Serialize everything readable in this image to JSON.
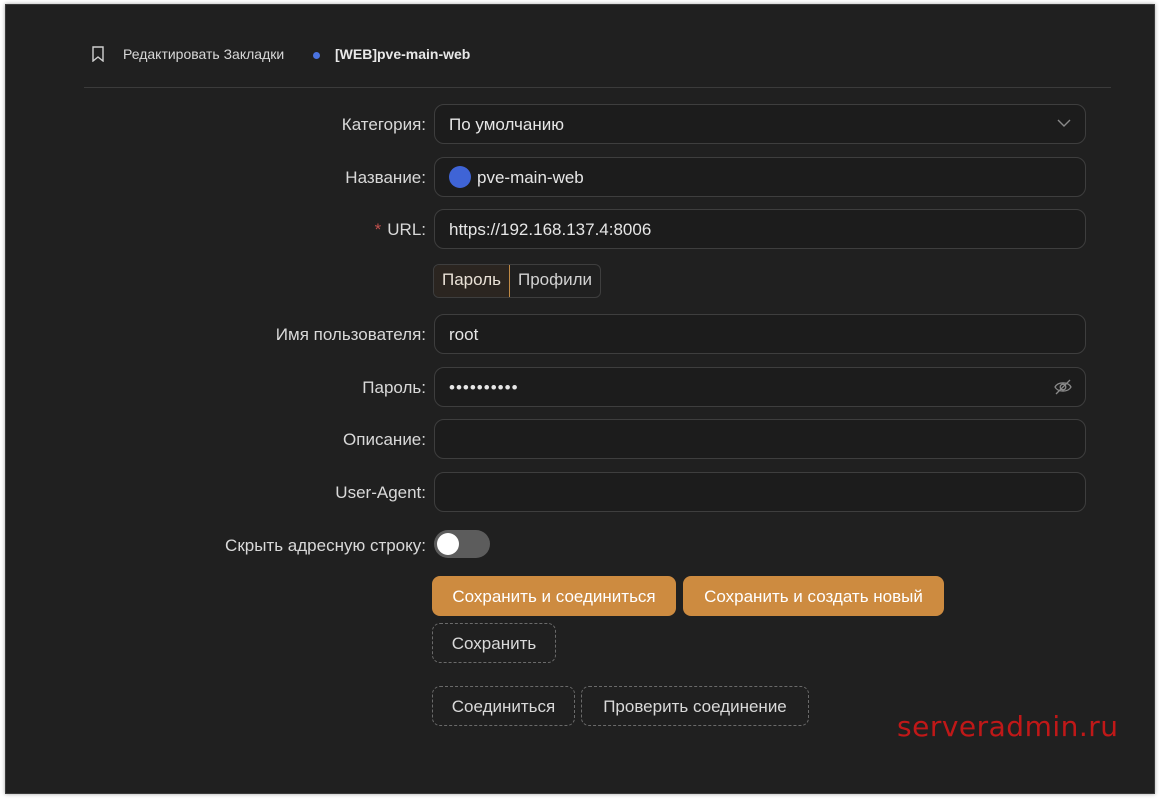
{
  "header": {
    "bookmark_title": "Редактировать Закладки",
    "tab_title": "[WEB]pve-main-web",
    "icon": "bookmark-icon"
  },
  "form": {
    "category": {
      "label": "Категория:",
      "value": "По умолчанию"
    },
    "name": {
      "label": "Название:",
      "value": "pve-main-web",
      "color": "#3f64d6"
    },
    "url": {
      "required_mark": "*",
      "label": "URL:",
      "value": "https://192.168.137.4:8006"
    },
    "auth_tabs": {
      "password": "Пароль",
      "profiles": "Профили",
      "selected": "Пароль"
    },
    "username": {
      "label": "Имя пользователя:",
      "value": "root"
    },
    "password": {
      "label": "Пароль:",
      "value": "••••••••••",
      "icon": "eye-off-icon"
    },
    "description": {
      "label": "Описание:",
      "value": ""
    },
    "user_agent": {
      "label": "User-Agent:",
      "value": ""
    },
    "hide_address_bar": {
      "label": "Скрыть адресную строку:",
      "state": "off"
    }
  },
  "buttons": {
    "save_connect": "Сохранить и соединиться",
    "save_new": "Сохранить и создать новый",
    "save": "Сохранить",
    "connect": "Соединиться",
    "test_connection": "Проверить соединение"
  },
  "watermark": "serveradmin.ru",
  "colors": {
    "accent": "#cd8b40",
    "background": "#202020",
    "tab_dot": "#4a73e0"
  }
}
